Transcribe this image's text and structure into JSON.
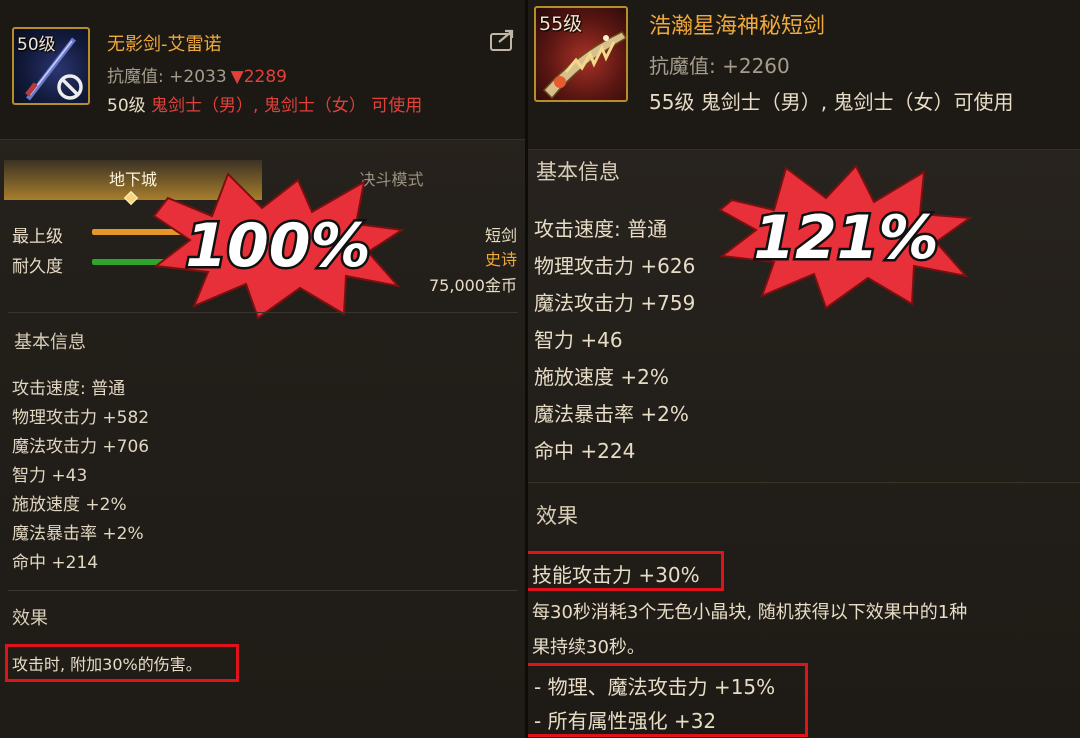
{
  "left": {
    "item": {
      "level": "50级",
      "name": "无影剑-艾雷诺",
      "stat_prefix": "抗魔值: +2033",
      "stat_compare": "▼2289",
      "usable_level": "50级",
      "usable_classes": "鬼剑士（男）, 鬼剑士（女）",
      "usable_suffix": "可使用",
      "icon": "sword-disabled-icon"
    },
    "tabs": [
      "地下城",
      "决斗模式"
    ],
    "gauges": [
      {
        "label": "最上级",
        "color": "#e5972a",
        "fill": 1.0
      },
      {
        "label": "耐久度",
        "color": "#2fa52c",
        "fill": 1.0
      }
    ],
    "type_labels": {
      "weapon": "短剑",
      "rarity": "史诗",
      "price": "75,000金币"
    },
    "burst_text": "100%",
    "basic_title": "基本信息",
    "stats": [
      "攻击速度: 普通",
      "物理攻击力 +582",
      "魔法攻击力 +706",
      "智力 +43",
      "施放速度 +2%",
      "魔法暴击率 +2%",
      "命中 +214"
    ],
    "effect_title": "效果",
    "effect": "攻击时, 附加30%的伤害。"
  },
  "right": {
    "item": {
      "level": "55级",
      "name": "浩瀚星海神秘短剑",
      "stat": "抗魔值: +2260",
      "usable": "55级 鬼剑士（男）, 鬼剑士（女）可使用",
      "icon": "mystic-dagger-icon"
    },
    "burst_text": "121%",
    "basic_title": "基本信息",
    "stats": [
      "攻击速度: 普通",
      "物理攻击力 +626",
      "魔法攻击力 +759",
      "智力 +46",
      "施放速度 +2%",
      "魔法暴击率 +2%",
      "命中 +224"
    ],
    "effect_title": "效果",
    "effect_main": "技能攻击力 +30%",
    "effect_desc_1": "每30秒消耗3个无色小晶块, 随机获得以下效果中的1种",
    "effect_desc_2": "果持续30秒。",
    "effect_opt_1": "- 物理、魔法攻击力 +15%",
    "effect_opt_2": "- 所有属性强化 +32"
  },
  "colors": {
    "gold": "#f0a93a",
    "red": "#e0413a",
    "highlight_box": "#e1131a",
    "burst_fill": "#e8303a"
  }
}
